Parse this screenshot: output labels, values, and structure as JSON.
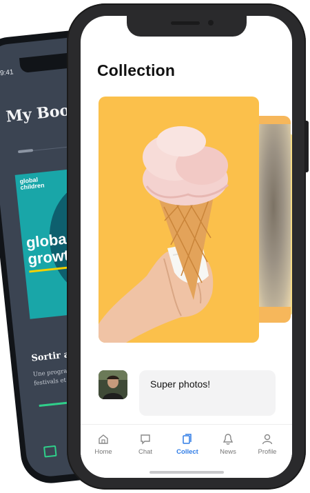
{
  "back_phone": {
    "time": "9:41",
    "title": "My Bookc",
    "poster": {
      "tag_line1": "global",
      "tag_line2": "children",
      "headline": "global growth"
    },
    "book_title": "Sortir a Canne",
    "book_desc": "Une programmation. Pala festivals et des con…",
    "progress": 0.3
  },
  "screen": {
    "title": "Collection",
    "comment": {
      "text": "Super photos!"
    },
    "tabs": [
      {
        "label": "Home",
        "icon": "home-icon",
        "active": false
      },
      {
        "label": "Chat",
        "icon": "chat-icon",
        "active": false
      },
      {
        "label": "Collect",
        "icon": "collect-icon",
        "active": true
      },
      {
        "label": "News",
        "icon": "bell-icon",
        "active": false
      },
      {
        "label": "Profile",
        "icon": "profile-icon",
        "active": false
      }
    ]
  },
  "colors": {
    "accent": "#2e7be6",
    "card_yellow": "#fbc04b",
    "back_phone_bg": "#3b4452",
    "progress_green": "#2fd08a"
  }
}
